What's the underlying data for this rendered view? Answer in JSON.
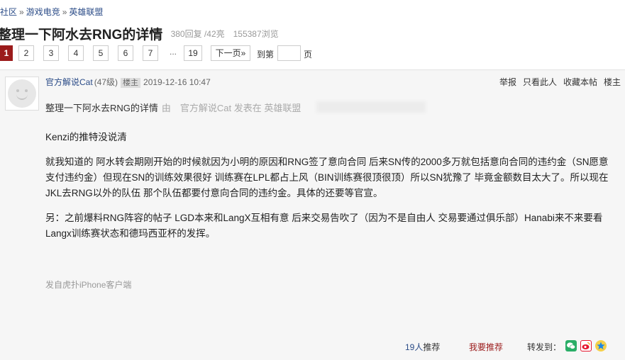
{
  "breadcrumb": [
    "社区",
    "游戏电竞",
    "英雄联盟"
  ],
  "breadcrumb_sep": "»",
  "thread": {
    "title": "整理一下阿水去RNG的详情",
    "stats": "380回复 /42亮　155387浏览"
  },
  "pager": {
    "pages": [
      "1",
      "2",
      "3",
      "4",
      "5",
      "6",
      "7"
    ],
    "current": "1",
    "ellipsis": "...",
    "last": "19",
    "next": "下一页»",
    "goto_prefix": "到第",
    "goto_suffix": "页"
  },
  "post": {
    "author": "官方解说Cat",
    "level": "(47级)",
    "badge": "楼主",
    "time": "2019-12-16 10:47",
    "actions": [
      "举报",
      "只看此人",
      "收藏本帖",
      "楼主"
    ],
    "title": "整理一下阿水去RNG的详情",
    "byline": "由　官方解说Cat 发表在 英雄联盟",
    "paragraphs": [
      "Kenzi的推特没说清",
      "就我知道的 阿水转会期刚开始的时候就因为小明的原因和RNG签了意向合同 后来SN传的2000多万就包括意向合同的违约金（SN愿意支付违约金）但现在SN的训练效果很好 训练赛在LPL都占上风（BIN训练赛很顶很顶）所以SN犹豫了 毕竟金额数目太大了。所以现在JKL去RNG以外的队伍 那个队伍都要付意向合同的违约金。具体的还要等官宣。",
      "另：之前爆料RNG阵容的帖子 LGD本来和LangX互相有意 后来交易告吹了（因为不是自由人 交易要通过俱乐部）Hanabi来不来要看Langx训练赛状态和德玛西亚杯的发挥。"
    ],
    "source": "发自虎扑iPhone客户端",
    "recommend_count": "19人",
    "recommend_label": "推荐",
    "recommend_button": "我要推荐",
    "share_label": "转发到："
  },
  "share_icons": [
    {
      "name": "wechat-icon",
      "color": "#2aae67"
    },
    {
      "name": "weibo-icon",
      "color": "#e6162d"
    },
    {
      "name": "qzone-icon",
      "color": "#f5a623"
    }
  ]
}
